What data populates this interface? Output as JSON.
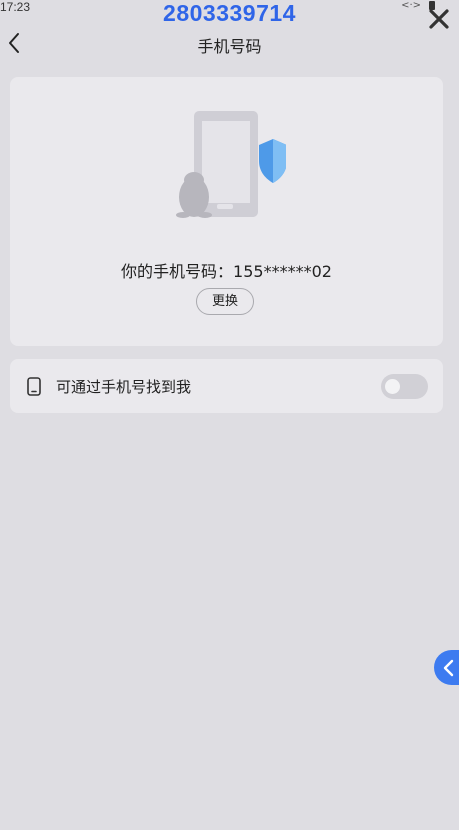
{
  "status_bar": {
    "time": "17:23",
    "signal": "<·>"
  },
  "overlay_id": "2803339714",
  "header": {
    "title": "手机号码"
  },
  "phone_card": {
    "label": "你的手机号码：",
    "number": "155******02",
    "change_button": "更换"
  },
  "find_setting": {
    "label": "可通过手机号找到我",
    "enabled": false
  },
  "icons": {
    "back": "back-chevron-icon",
    "close": "close-icon",
    "device": "mobile-phone-icon",
    "side": "side-drawer-chevron-icon"
  },
  "colors": {
    "accent": "#3d7bf0",
    "overlay": "#2f65e8",
    "background": "#dedde2",
    "card": "#eae9ed"
  }
}
